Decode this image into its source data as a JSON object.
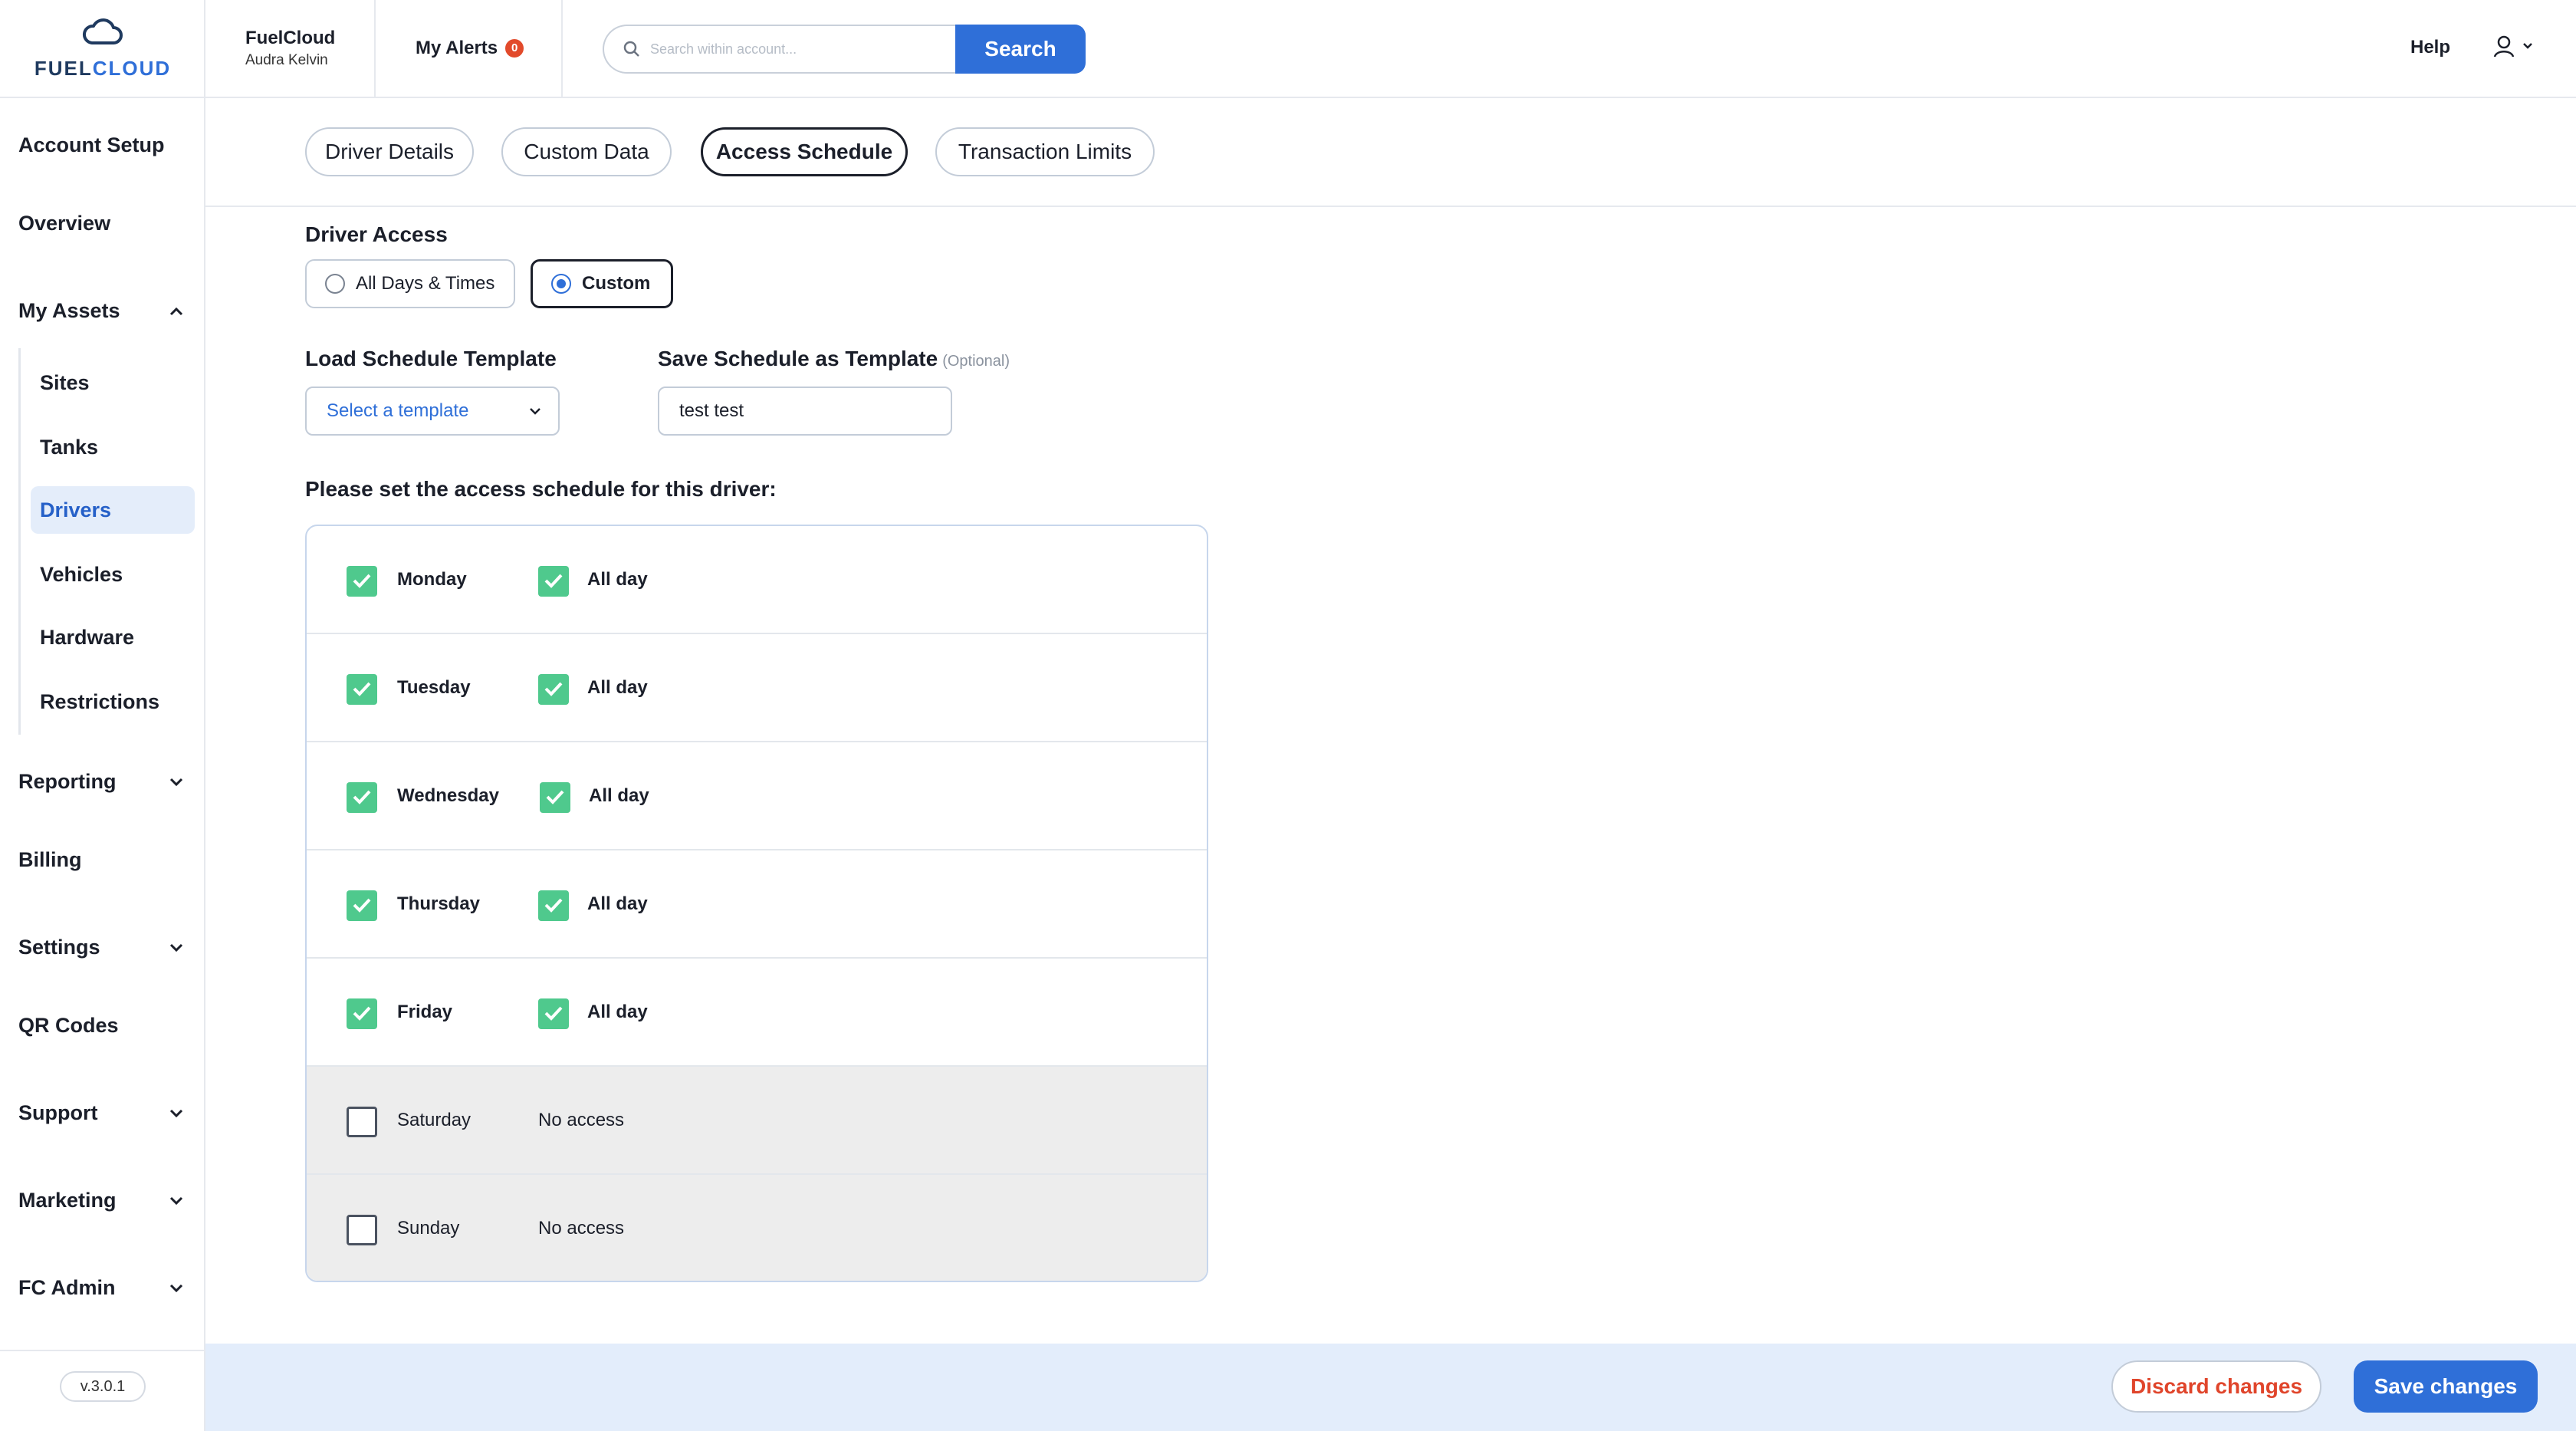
{
  "brand": {
    "logo_text_a": "FUEL",
    "logo_text_b": "CLOUD"
  },
  "header": {
    "account_name": "FuelCloud",
    "user_name": "Audra Kelvin",
    "alerts_label": "My Alerts",
    "alerts_count": "0",
    "search_placeholder": "Search within account...",
    "search_button": "Search",
    "help_label": "Help"
  },
  "sidebar": {
    "items": [
      {
        "label": "Account Setup"
      },
      {
        "label": "Overview"
      },
      {
        "label": "My Assets",
        "expanded": true
      },
      {
        "label": "Reporting"
      },
      {
        "label": "Billing"
      },
      {
        "label": "Settings"
      },
      {
        "label": "QR Codes"
      },
      {
        "label": "Support"
      },
      {
        "label": "Marketing"
      },
      {
        "label": "FC Admin"
      }
    ],
    "sub_items": [
      {
        "label": "Sites"
      },
      {
        "label": "Tanks"
      },
      {
        "label": "Drivers",
        "active": true
      },
      {
        "label": "Vehicles"
      },
      {
        "label": "Hardware"
      },
      {
        "label": "Restrictions"
      }
    ],
    "version": "v.3.0.1"
  },
  "tabs": [
    {
      "label": "Driver Details"
    },
    {
      "label": "Custom Data"
    },
    {
      "label": "Access Schedule",
      "active": true
    },
    {
      "label": "Transaction Limits"
    }
  ],
  "access": {
    "title": "Driver Access",
    "options": [
      {
        "label": "All Days & Times",
        "selected": false
      },
      {
        "label": "Custom",
        "selected": true
      }
    ]
  },
  "template": {
    "load_label": "Load Schedule Template",
    "select_placeholder": "Select a template",
    "save_label": "Save Schedule as Template",
    "optional_label": "(Optional)",
    "save_value": "test test"
  },
  "schedule": {
    "prompt": "Please set the access schedule for this driver:",
    "days": [
      {
        "day": "Monday",
        "enabled": true,
        "detail": "All day"
      },
      {
        "day": "Tuesday",
        "enabled": true,
        "detail": "All day"
      },
      {
        "day": "Wednesday",
        "enabled": true,
        "detail": "All day"
      },
      {
        "day": "Thursday",
        "enabled": true,
        "detail": "All day"
      },
      {
        "day": "Friday",
        "enabled": true,
        "detail": "All day"
      },
      {
        "day": "Saturday",
        "enabled": false,
        "detail": "No access"
      },
      {
        "day": "Sunday",
        "enabled": false,
        "detail": "No access"
      }
    ]
  },
  "actions": {
    "discard": "Discard changes",
    "save": "Save changes"
  },
  "colors": {
    "accent": "#2f6fd8",
    "check": "#4fc98d",
    "danger": "#e0452b",
    "active_bg": "#e4edfa"
  }
}
